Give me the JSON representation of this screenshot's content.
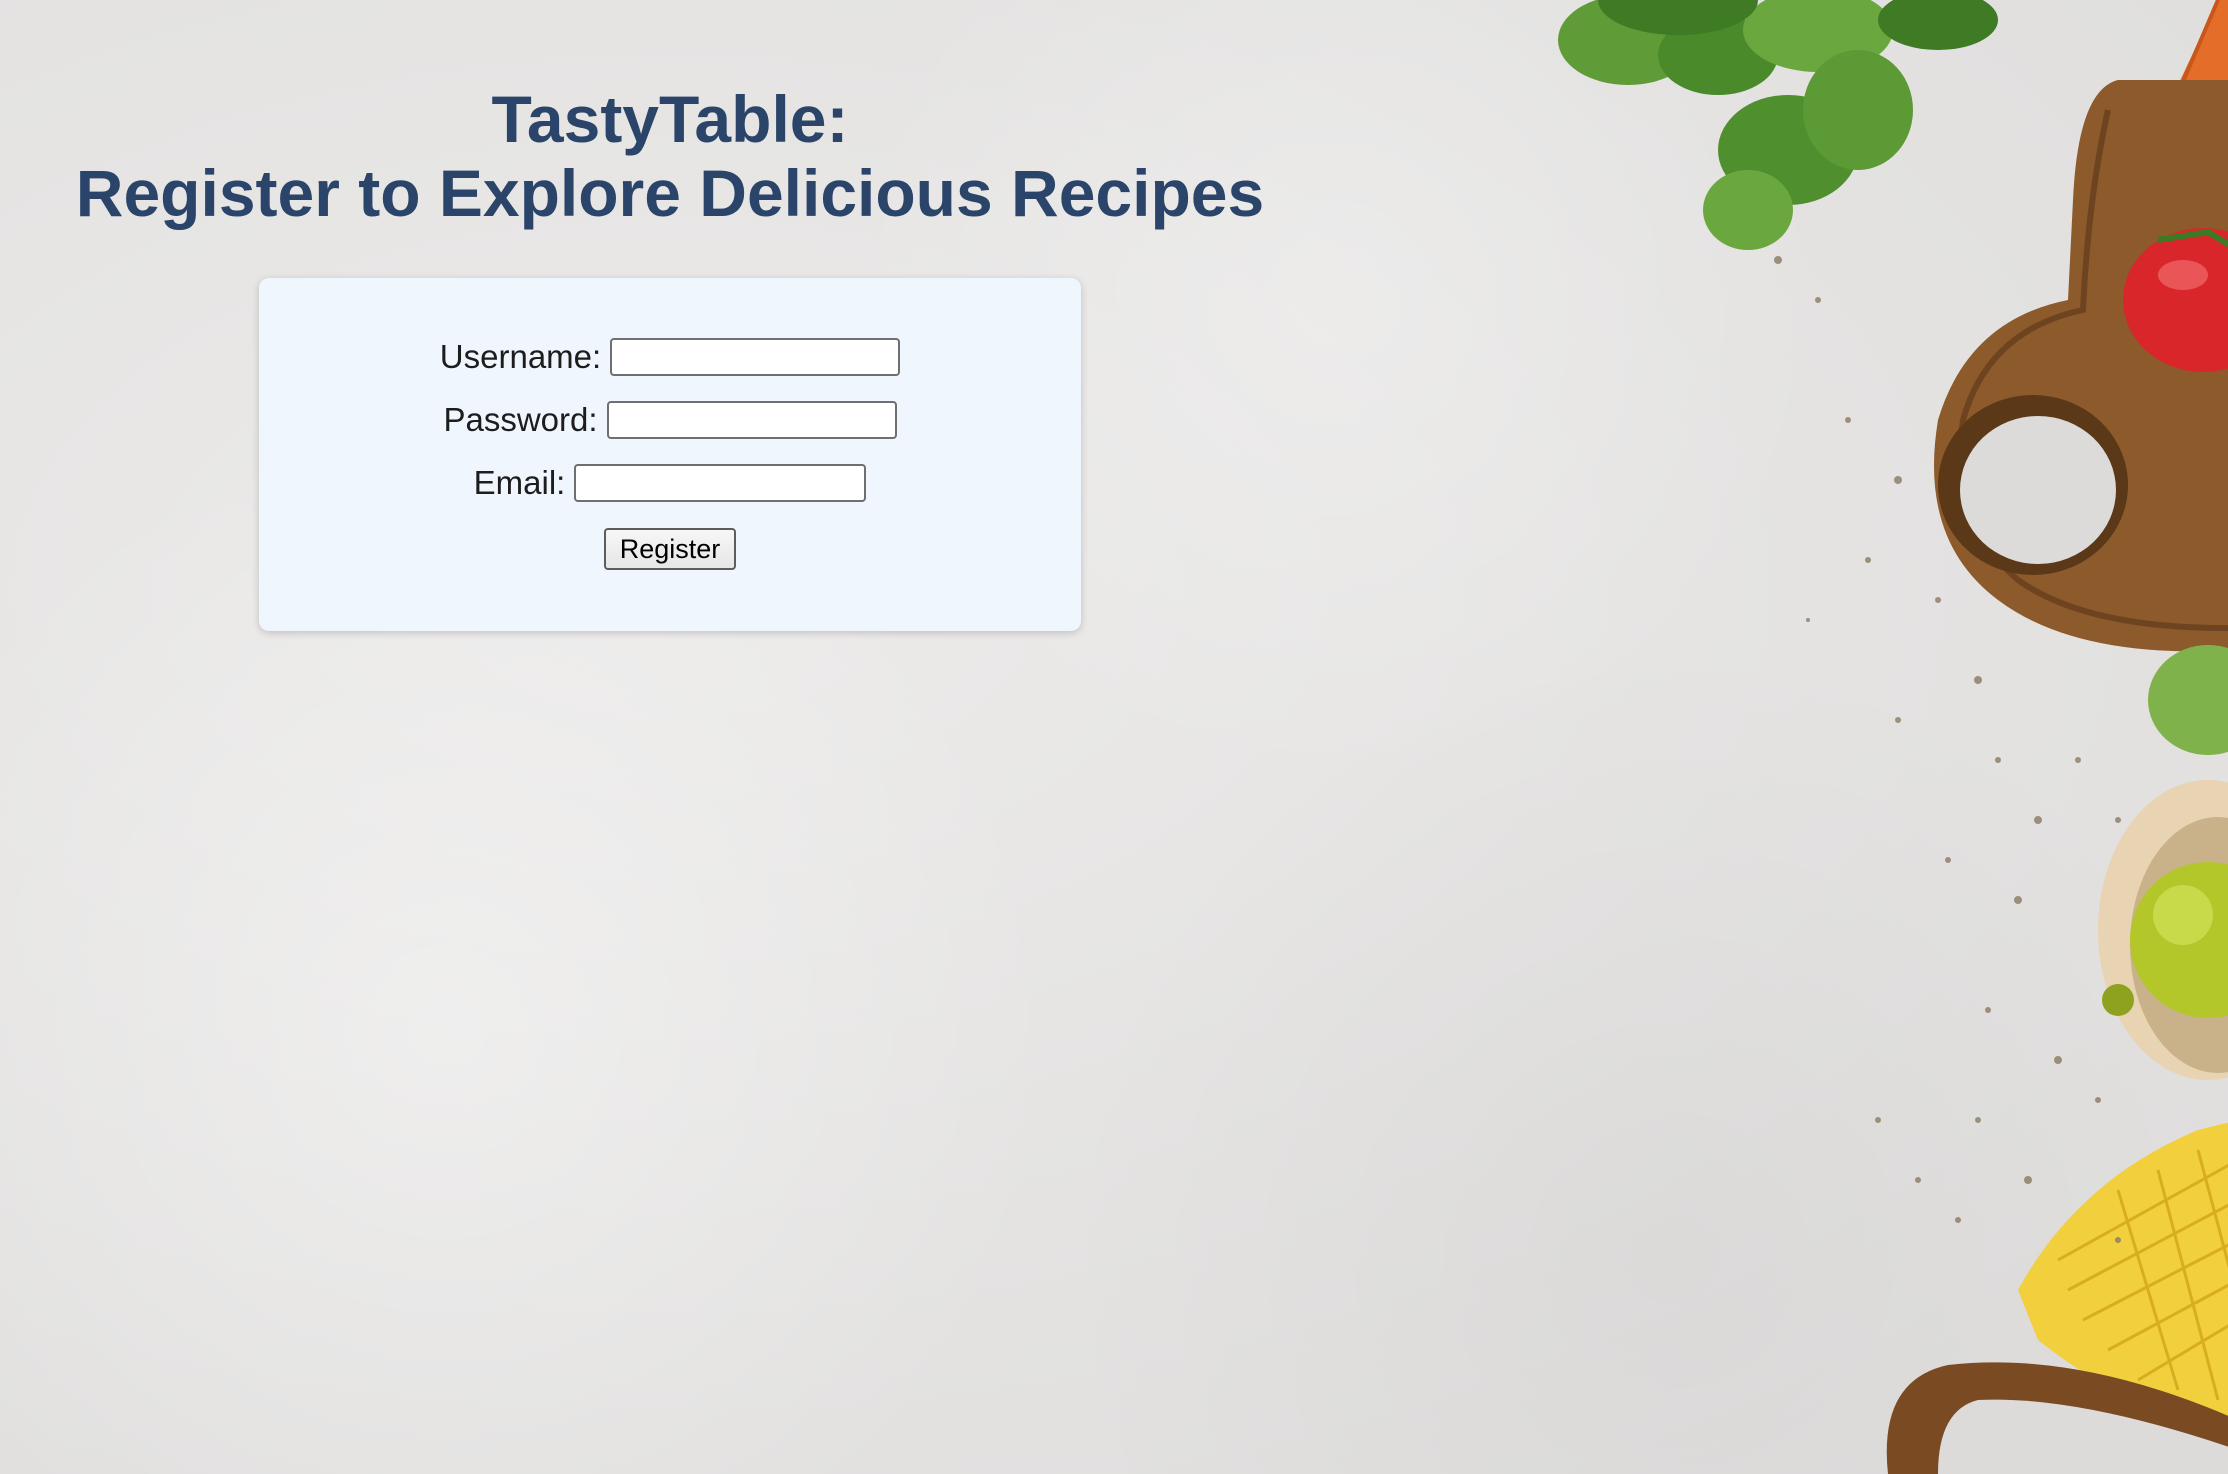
{
  "page": {
    "heading_line1": "TastyTable:",
    "heading_line2": "Register to Explore Delicious Recipes"
  },
  "form": {
    "username_label": "Username:",
    "username_value": "",
    "password_label": "Password:",
    "password_value": "",
    "email_label": "Email:",
    "email_value": "",
    "register_button": "Register"
  },
  "colors": {
    "heading": "#2b4469",
    "card_background": "#eff6fd",
    "page_background": "#e5e4e3"
  },
  "decor": {
    "image": "vegetables-cutting-board-photo"
  }
}
